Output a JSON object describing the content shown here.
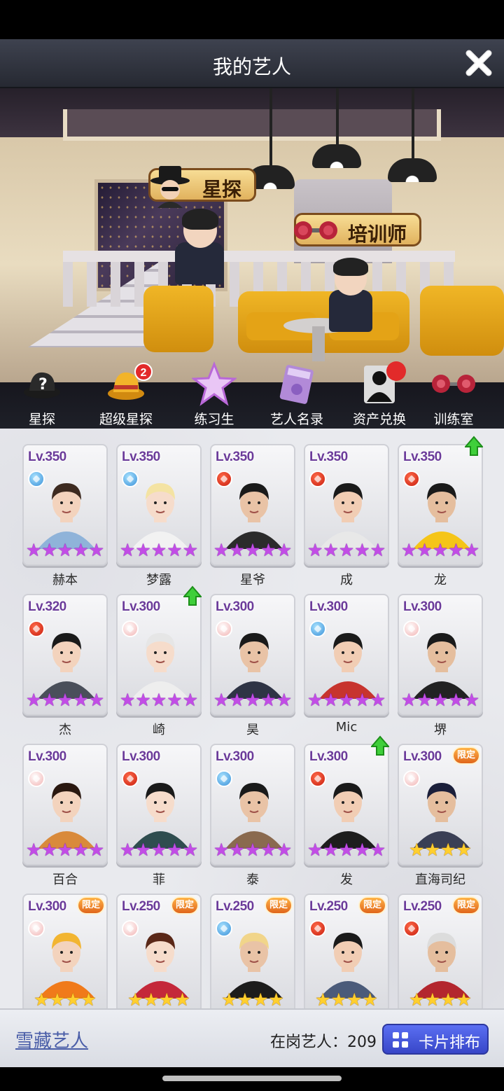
{
  "header": {
    "title": "我的艺人"
  },
  "scene": {
    "scout_sign": "星探",
    "trainer_sign": "培训师"
  },
  "menu": [
    {
      "label": "星探",
      "icon": "scout-hat-icon"
    },
    {
      "label": "超级星探",
      "icon": "super-scout-hat-icon",
      "badge": "2"
    },
    {
      "label": "练习生",
      "icon": "trainee-star-icon"
    },
    {
      "label": "艺人名录",
      "icon": "star-book-icon"
    },
    {
      "label": "资产兑换",
      "icon": "silhouette-icon",
      "dot": true
    },
    {
      "label": "训练室",
      "icon": "dumbbell-icon"
    }
  ],
  "cards": [
    {
      "level": "Lv.350",
      "name": "赫本",
      "attr": "blue",
      "stars": 5,
      "star_color": "purple",
      "limited": false,
      "up": false
    },
    {
      "level": "Lv.350",
      "name": "梦露",
      "attr": "blue",
      "stars": 5,
      "star_color": "purple",
      "limited": false,
      "up": false
    },
    {
      "level": "Lv.350",
      "name": "星爷",
      "attr": "red",
      "stars": 5,
      "star_color": "purple",
      "limited": false,
      "up": false
    },
    {
      "level": "Lv.350",
      "name": "成",
      "attr": "red",
      "stars": 5,
      "star_color": "purple",
      "limited": false,
      "up": false
    },
    {
      "level": "Lv.350",
      "name": "龙",
      "attr": "red",
      "stars": 5,
      "star_color": "purple",
      "limited": false,
      "up": true
    },
    {
      "level": "Lv.320",
      "name": "杰",
      "attr": "red",
      "stars": 5,
      "star_color": "purple",
      "limited": false,
      "up": false
    },
    {
      "level": "Lv.300",
      "name": "崎",
      "attr": "pink",
      "stars": 5,
      "star_color": "purple",
      "limited": false,
      "up": true
    },
    {
      "level": "Lv.300",
      "name": "昊",
      "attr": "pink",
      "stars": 5,
      "star_color": "purple",
      "limited": false,
      "up": false
    },
    {
      "level": "Lv.300",
      "name": "Mic",
      "attr": "blue",
      "stars": 5,
      "star_color": "purple",
      "limited": false,
      "up": false
    },
    {
      "level": "Lv.300",
      "name": "堺",
      "attr": "pink",
      "stars": 5,
      "star_color": "purple",
      "limited": false,
      "up": false
    },
    {
      "level": "Lv.300",
      "name": "百合",
      "attr": "pink",
      "stars": 5,
      "star_color": "purple",
      "limited": false,
      "up": false
    },
    {
      "level": "Lv.300",
      "name": "菲",
      "attr": "red",
      "stars": 5,
      "star_color": "purple",
      "limited": false,
      "up": false
    },
    {
      "level": "Lv.300",
      "name": "泰",
      "attr": "blue",
      "stars": 5,
      "star_color": "purple",
      "limited": false,
      "up": false
    },
    {
      "level": "Lv.300",
      "name": "发",
      "attr": "red",
      "stars": 5,
      "star_color": "purple",
      "limited": false,
      "up": true
    },
    {
      "level": "Lv.300",
      "name": "直海司纪",
      "attr": "pink",
      "stars": 4,
      "star_color": "gold",
      "limited": true,
      "up": false
    },
    {
      "level": "Lv.300",
      "name": "",
      "attr": "pink",
      "stars": 4,
      "star_color": "gold",
      "limited": true,
      "up": false
    },
    {
      "level": "Lv.250",
      "name": "",
      "attr": "pink",
      "stars": 4,
      "star_color": "gold",
      "limited": true,
      "up": false
    },
    {
      "level": "Lv.250",
      "name": "",
      "attr": "blue",
      "stars": 4,
      "star_color": "gold",
      "limited": true,
      "up": false
    },
    {
      "level": "Lv.250",
      "name": "",
      "attr": "red",
      "stars": 4,
      "star_color": "gold",
      "limited": true,
      "up": false
    },
    {
      "level": "Lv.250",
      "name": "",
      "attr": "red",
      "stars": 4,
      "star_color": "gold",
      "limited": true,
      "up": false
    }
  ],
  "limited_badge": "限定",
  "bottom": {
    "hidden_artists": "雪藏艺人",
    "active_count_label": "在岗艺人：209",
    "layout_button": "卡片排布"
  }
}
